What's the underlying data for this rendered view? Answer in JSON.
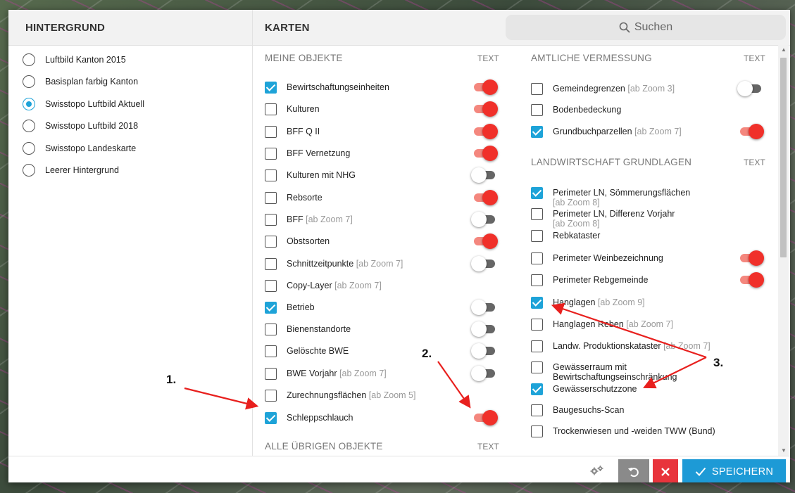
{
  "background_panel": {
    "title": "HINTERGRUND",
    "options": [
      {
        "label": "Luftbild Kanton 2015",
        "selected": false
      },
      {
        "label": "Basisplan farbig Kanton",
        "selected": false
      },
      {
        "label": "Swisstopo Luftbild Aktuell",
        "selected": true
      },
      {
        "label": "Swisstopo Luftbild 2018",
        "selected": false
      },
      {
        "label": "Swisstopo Landeskarte",
        "selected": false
      },
      {
        "label": "Leerer Hintergrund",
        "selected": false
      }
    ]
  },
  "maps_panel": {
    "title": "KARTEN",
    "search_placeholder": "Suchen",
    "meine_objekte": {
      "heading": "MEINE OBJEKTE",
      "text_label": "TEXT",
      "items": [
        {
          "label": "Bewirtschaftungseinheiten",
          "hint": "",
          "checked": true,
          "toggle": "on"
        },
        {
          "label": "Kulturen",
          "hint": "",
          "checked": false,
          "toggle": "on"
        },
        {
          "label": "BFF Q II",
          "hint": "",
          "checked": false,
          "toggle": "on"
        },
        {
          "label": "BFF Vernetzung",
          "hint": "",
          "checked": false,
          "toggle": "on"
        },
        {
          "label": "Kulturen mit NHG",
          "hint": "",
          "checked": false,
          "toggle": "off"
        },
        {
          "label": "Rebsorte",
          "hint": "",
          "checked": false,
          "toggle": "on"
        },
        {
          "label": "BFF",
          "hint": "[ab Zoom 7]",
          "checked": false,
          "toggle": "off"
        },
        {
          "label": "Obstsorten",
          "hint": "",
          "checked": false,
          "toggle": "on"
        },
        {
          "label": "Schnittzeitpunkte",
          "hint": "[ab Zoom 7]",
          "checked": false,
          "toggle": "off"
        },
        {
          "label": "Copy-Layer",
          "hint": "[ab Zoom 7]",
          "checked": false,
          "toggle": "none"
        },
        {
          "label": "Betrieb",
          "hint": "",
          "checked": true,
          "toggle": "off"
        },
        {
          "label": "Bienenstandorte",
          "hint": "",
          "checked": false,
          "toggle": "off"
        },
        {
          "label": "Gelöschte BWE",
          "hint": "",
          "checked": false,
          "toggle": "off"
        },
        {
          "label": "BWE Vorjahr",
          "hint": "[ab Zoom 7]",
          "checked": false,
          "toggle": "off"
        },
        {
          "label": "Zurechnungsflächen",
          "hint": "[ab Zoom 5]",
          "checked": false,
          "toggle": "none"
        },
        {
          "label": "Schleppschlauch",
          "hint": "",
          "checked": true,
          "toggle": "on"
        }
      ]
    },
    "alle_uebrigen": {
      "heading": "ALLE ÜBRIGEN OBJEKTE",
      "text_label": "TEXT"
    },
    "amtliche_vermessung": {
      "heading": "AMTLICHE VERMESSUNG",
      "text_label": "TEXT",
      "items": [
        {
          "label": "Gemeindegrenzen",
          "hint": "[ab Zoom 3]",
          "checked": false,
          "toggle": "off"
        },
        {
          "label": "Bodenbedeckung",
          "hint": "",
          "checked": false,
          "toggle": "none"
        },
        {
          "label": "Grundbuchparzellen",
          "hint": "[ab Zoom 7]",
          "checked": true,
          "toggle": "on"
        }
      ]
    },
    "landwirtschaft": {
      "heading": "LANDWIRTSCHAFT GRUNDLAGEN",
      "text_label": "TEXT",
      "items": [
        {
          "label": "Perimeter LN, Sömmerungsflächen",
          "hint": "[ab Zoom 8]",
          "checked": true,
          "toggle": "none"
        },
        {
          "label": "Perimeter LN, Differenz Vorjahr",
          "hint": "[ab Zoom 8]",
          "checked": false,
          "toggle": "none"
        },
        {
          "label": "Rebkataster",
          "hint": "",
          "checked": false,
          "toggle": "none"
        },
        {
          "label": "Perimeter Weinbezeichnung",
          "hint": "",
          "checked": false,
          "toggle": "on"
        },
        {
          "label": "Perimeter Rebgemeinde",
          "hint": "",
          "checked": false,
          "toggle": "on"
        },
        {
          "label": "Hanglagen",
          "hint": "[ab Zoom 9]",
          "checked": true,
          "toggle": "none"
        },
        {
          "label": "Hanglagen Reben",
          "hint": "[ab Zoom 7]",
          "checked": false,
          "toggle": "none"
        },
        {
          "label": "Landw. Produktionskataster",
          "hint": "[ab Zoom 7]",
          "checked": false,
          "toggle": "none"
        },
        {
          "label": "Gewässerraum mit Bewirtschaftungseinschränkung",
          "hint": "",
          "checked": false,
          "toggle": "none"
        },
        {
          "label": "Gewässerschutzzone",
          "hint": "",
          "checked": true,
          "toggle": "none"
        },
        {
          "label": "Baugesuchs-Scan",
          "hint": "",
          "checked": false,
          "toggle": "none"
        },
        {
          "label": "Trockenwiesen und -weiden TWW (Bund)",
          "hint": "",
          "checked": false,
          "toggle": "none"
        }
      ]
    }
  },
  "footer": {
    "save_label": "SPEICHERN",
    "settings_icon": "gears-icon",
    "reset_icon": "undo-icon",
    "cancel_icon": "close-icon"
  },
  "annotations": [
    "1.",
    "2.",
    "3."
  ],
  "colors": {
    "accent": "#1d9ad6",
    "toggle_on": "#f0302a",
    "cancel": "#e8343c",
    "reset": "#8a8a8a"
  }
}
